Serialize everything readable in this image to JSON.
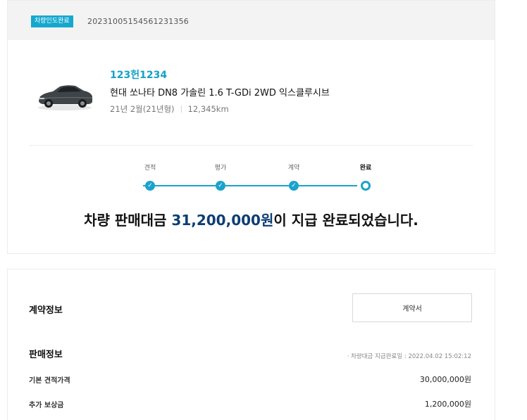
{
  "order": {
    "status_badge": "차량인도완료",
    "number": "20231005154561231356"
  },
  "vehicle": {
    "plate": "123헌1234",
    "model": "현대 쏘나타 DN8 가솔린 1.6 T-GDi 2WD 익스클루시브",
    "year": "21년 2월(21년형)",
    "mileage": "12,345km",
    "image_icon": "car-thumbnail"
  },
  "progress": {
    "steps": [
      {
        "label": "견적",
        "state": "done"
      },
      {
        "label": "평가",
        "state": "done"
      },
      {
        "label": "계약",
        "state": "done"
      },
      {
        "label": "완료",
        "state": "current"
      }
    ],
    "accent_color": "#1aa3cc"
  },
  "headline": {
    "prefix": "차량 판매대금 ",
    "amount": "31,200,000원",
    "suffix": "이 지급 완료되었습니다."
  },
  "contract": {
    "title": "계약정보",
    "button_label": "계약서"
  },
  "sale": {
    "title": "판매정보",
    "pay_date": "· 차량대금 지급완료일 : 2022.04.02 15:02:12",
    "rows": [
      {
        "label": "기본 견적가격",
        "value": "30,000,000원"
      },
      {
        "label": "추가 보상금",
        "value": "1,200,000원"
      }
    ]
  }
}
